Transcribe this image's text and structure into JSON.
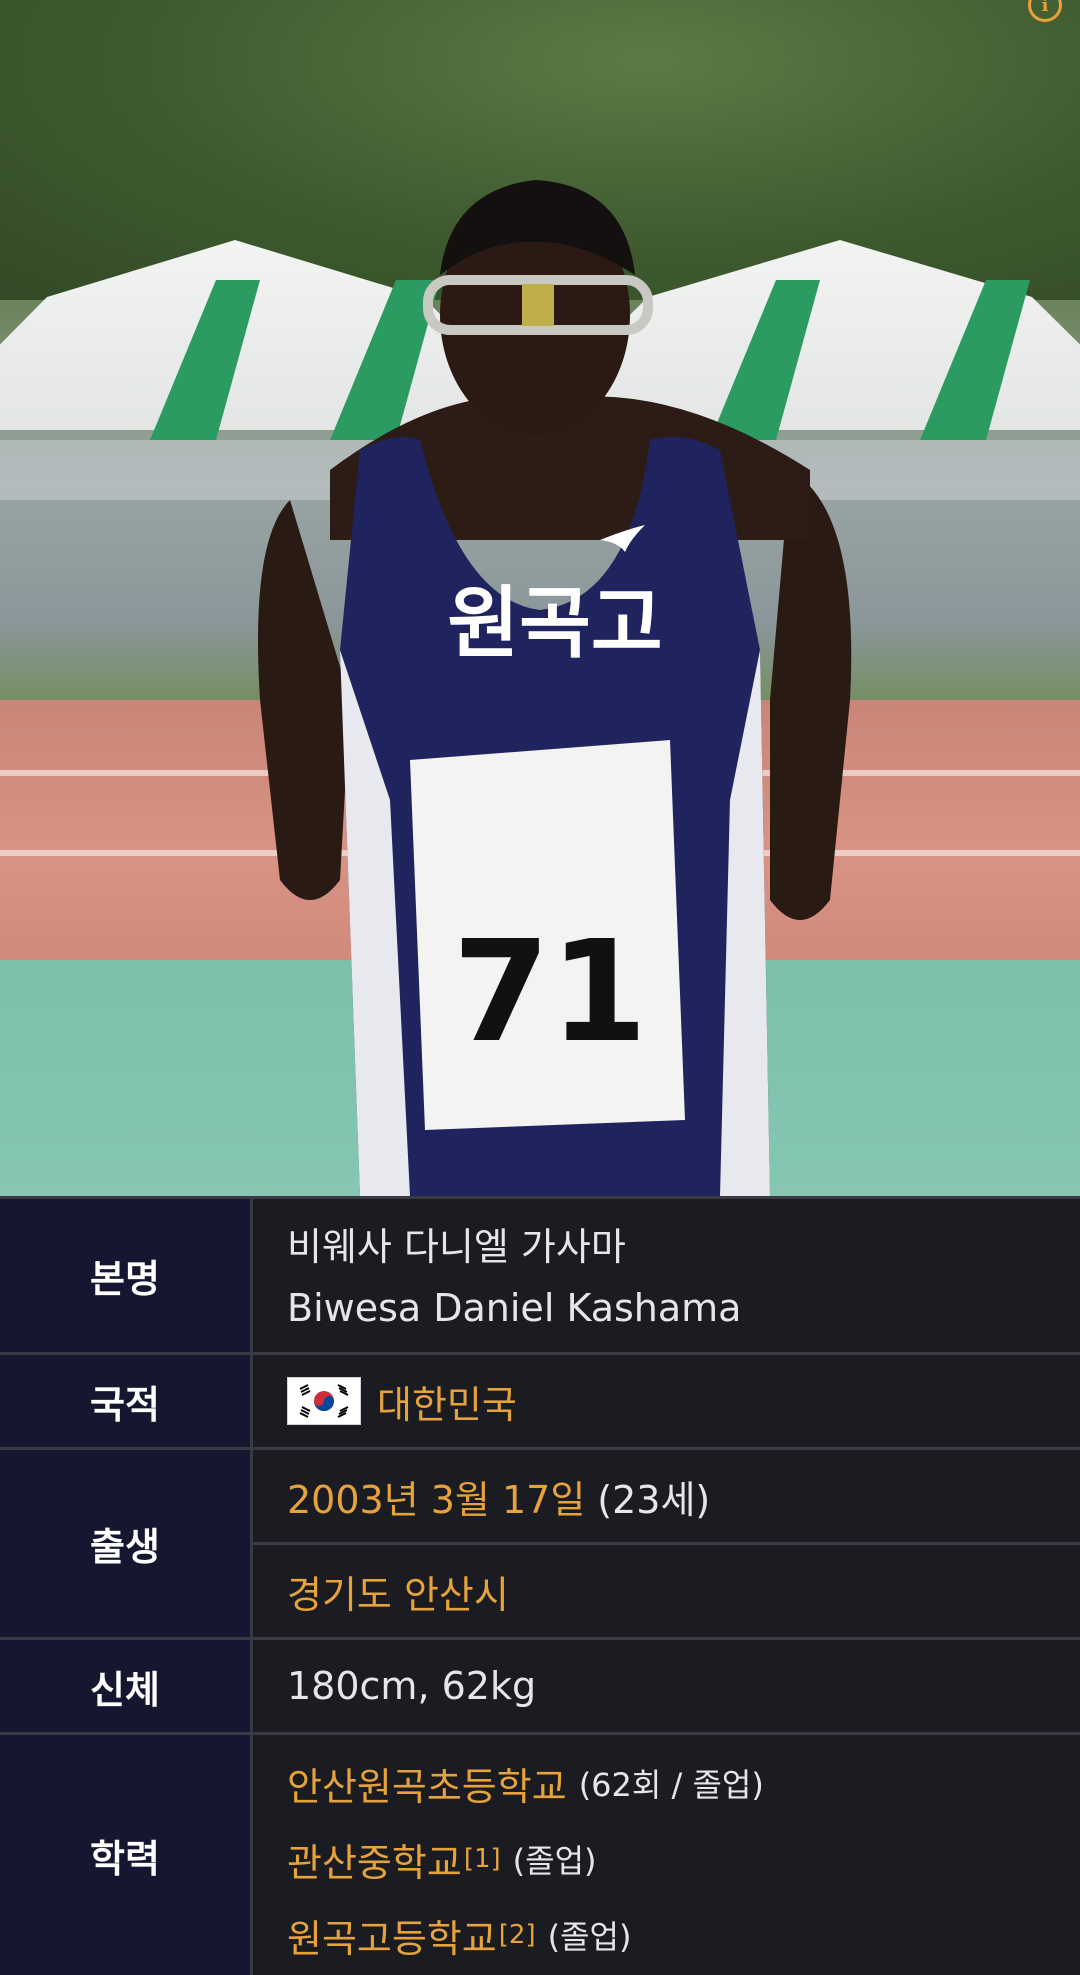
{
  "photo": {
    "bib_number": "71",
    "jersey_text": "원곡고"
  },
  "info": {
    "name": {
      "label": "본명",
      "korean": "비웨사 다니엘 가사마",
      "english": "Biwesa Daniel Kashama"
    },
    "nationality": {
      "label": "국적",
      "flag_icon": "south-korea-flag-icon",
      "country": "대한민국"
    },
    "birth": {
      "label": "출생",
      "date": "2003년 3월 17일",
      "age": "(23세)",
      "place": "경기도 안산시"
    },
    "body": {
      "label": "신체",
      "value": "180cm, 62kg"
    },
    "education": {
      "label": "학력",
      "schools": [
        {
          "name": "안산원곡초등학교",
          "ref": "",
          "note": "(62회 / 졸업)"
        },
        {
          "name": "관산중학교",
          "ref": "[1]",
          "note": "(졸업)"
        },
        {
          "name": "원곡고등학교",
          "ref": "[2]",
          "note": "(졸업)"
        }
      ]
    }
  },
  "colors": {
    "link": "#e7a33b",
    "label_bg": "#161630",
    "value_bg": "#1b1b22"
  }
}
